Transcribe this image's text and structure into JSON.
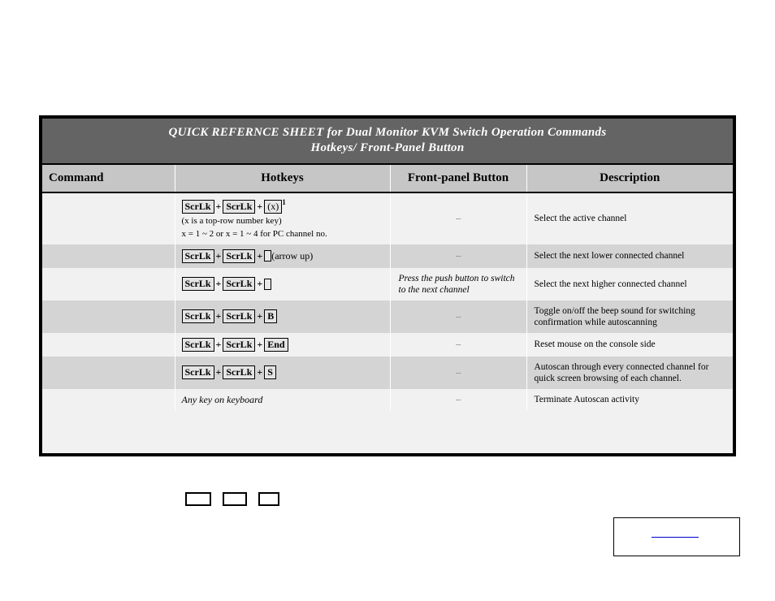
{
  "document": {
    "title_line1": "QUICK   REFERNCE   SHEET  for   Dual Monitor  KVM   Switch   Operation   Commands",
    "title_line2": "Hotkeys/  Front-Panel Button"
  },
  "table": {
    "columns": [
      "Command",
      "Hotkeys",
      "Front-panel Button",
      "Description"
    ],
    "rows": [
      {
        "command": "",
        "hotkeys": {
          "keys": [
            "ScrLk",
            "ScrLk",
            "(x)"
          ],
          "superscript": "1",
          "notes": [
            " (x is a top-row number key)",
            "x = 1 ~ 2 or x = 1 ~ 4 for PC channel no."
          ],
          "arrow_label": "",
          "italic_text": ""
        },
        "front_panel": "--",
        "front_panel_is_note": false,
        "description": "Select the active channel",
        "shade": "light"
      },
      {
        "command": "",
        "hotkeys": {
          "keys": [
            "ScrLk",
            "ScrLk",
            "□"
          ],
          "superscript": "",
          "notes": [],
          "arrow_label": "(arrow up)",
          "italic_text": ""
        },
        "front_panel": "--",
        "front_panel_is_note": false,
        "description": "Select the next lower connected channel",
        "shade": "shade"
      },
      {
        "command": "",
        "hotkeys": {
          "keys": [
            "ScrLk",
            "ScrLk",
            "□"
          ],
          "superscript": "",
          "notes": [],
          "arrow_label": "",
          "italic_text": ""
        },
        "front_panel": "Press the push button to switch to the next channel",
        "front_panel_is_note": true,
        "description": "Select the next higher connected channel",
        "shade": "light"
      },
      {
        "command": "",
        "hotkeys": {
          "keys": [
            "ScrLk",
            "ScrLk",
            "B"
          ],
          "superscript": "",
          "notes": [],
          "arrow_label": "",
          "italic_text": ""
        },
        "front_panel": "--",
        "front_panel_is_note": false,
        "description": "Toggle on/off the beep sound for switching confirmation while autoscanning",
        "shade": "shade"
      },
      {
        "command": "",
        "hotkeys": {
          "keys": [
            "ScrLk",
            "ScrLk",
            "End"
          ],
          "superscript": "",
          "notes": [],
          "arrow_label": "",
          "italic_text": ""
        },
        "front_panel": "--",
        "front_panel_is_note": false,
        "description": "Reset mouse on the console side",
        "shade": "light"
      },
      {
        "command": "",
        "hotkeys": {
          "keys": [
            "ScrLk",
            "ScrLk",
            "S"
          ],
          "superscript": "",
          "notes": [],
          "arrow_label": "",
          "italic_text": ""
        },
        "front_panel": "--",
        "front_panel_is_note": false,
        "description": "Autoscan through every connected channel for quick screen browsing of each channel.",
        "shade": "shade"
      },
      {
        "command": "",
        "hotkeys": {
          "keys": [],
          "superscript": "",
          "notes": [],
          "arrow_label": "",
          "italic_text": "Any key on keyboard"
        },
        "front_panel": "--",
        "front_panel_is_note": false,
        "description": "Terminate Autoscan activity",
        "shade": "light"
      }
    ]
  },
  "footer": {
    "mini_boxes": [
      "",
      "",
      ""
    ],
    "link_box": {
      "link_text": ""
    }
  },
  "colors": {
    "banner_bg": "#646464",
    "header_bg": "#c6c6c6",
    "row_shade": "#d4d4d4",
    "row_light": "#f1f1f1",
    "border": "#000000",
    "link": "#0000cc"
  }
}
